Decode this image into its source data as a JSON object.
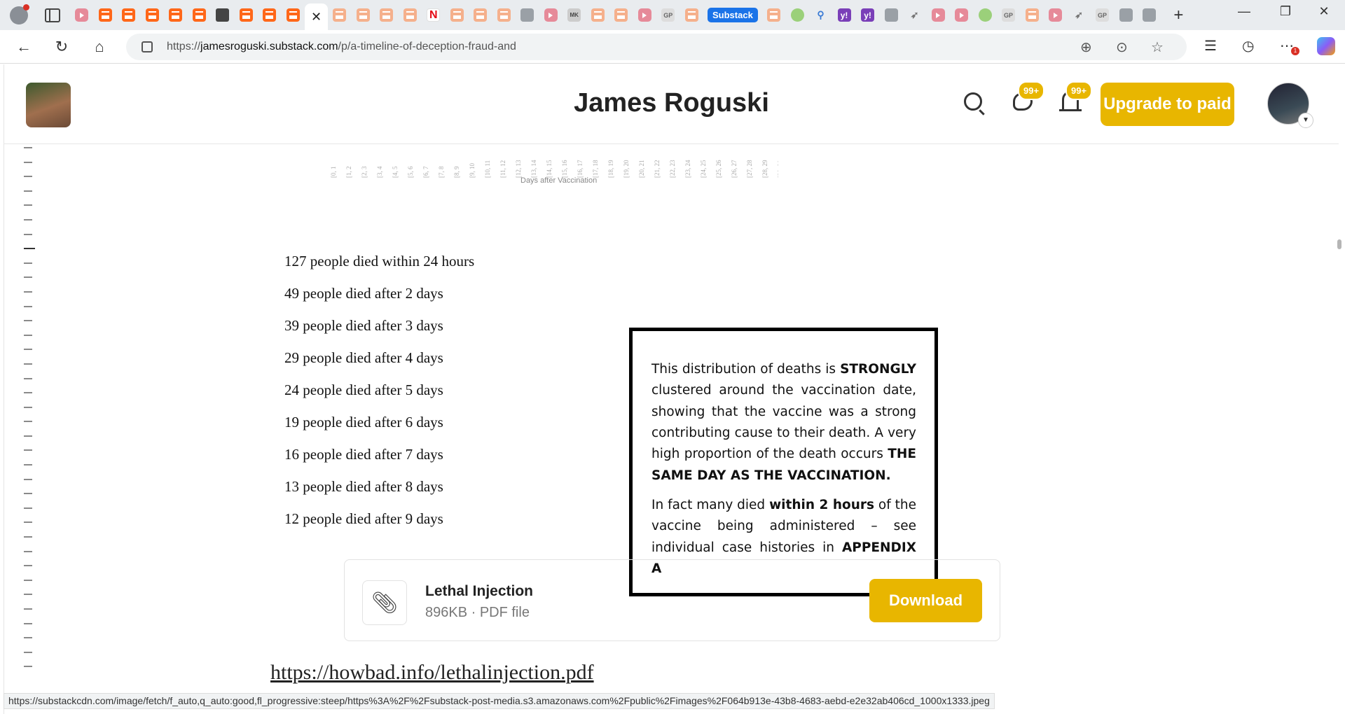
{
  "browser": {
    "substack_group_label": "Substack",
    "url_scheme": "https://",
    "url_domain": "jamesroguski.substack.com",
    "url_path": "/p/a-timeline-of-deception-fraud-and",
    "more_badge": "1",
    "status_url": "https://substackcdn.com/image/fetch/f_auto,q_auto:good,fl_progressive:steep/https%3A%2F%2Fsubstack-post-media.s3.amazonaws.com%2Fpublic%2Fimages%2F064b913e-43b8-4683-aebd-e2e32ab406cd_1000x1333.jpeg"
  },
  "header": {
    "site_title": "James Roguski",
    "chat_badge": "99+",
    "bell_badge": "99+",
    "upgrade_label": "Upgrade to paid",
    "accent_color": "#e8b600"
  },
  "document_image": {
    "axis_label": "Days after Vaccination",
    "axis_ticks": [
      "[0, 1",
      "[1, 2",
      "[2, 3",
      "[3, 4",
      "[4, 5",
      "[5, 6",
      "[6, 7",
      "[7, 8",
      "[8, 9",
      "[9, 10",
      "[10, 11",
      "[11, 12",
      "[12, 13",
      "[13, 14",
      "[14, 15",
      "[15, 16",
      "[16, 17",
      "[17, 18",
      "[18, 19",
      "[19, 20",
      "[20, 21",
      "[21, 22",
      "[22, 23",
      "[23, 24",
      "[24, 25",
      "[25, 26",
      "[26, 27",
      "[27, 28",
      "[28, 29",
      "[29, 30"
    ],
    "deaths": [
      "127 people died within 24 hours",
      "49 people died after 2 days",
      "39 people died after 3 days",
      "29 people died after 4 days",
      "24 people died after 5 days",
      "19 people died after 6 days",
      "16 people died after 7 days",
      "13 people died after 8 days",
      "12 people died after 9 days"
    ],
    "callout": {
      "p1_a": "This distribution of deaths is ",
      "p1_b": "STRONGLY",
      "p1_c": " clustered around the vaccination date, showing that the vaccine was a strong contributing cause to their death. A very high proportion of the death occurs ",
      "p1_d": "THE SAME DAY AS THE VACCINATION.",
      "p2_a": "In fact many died ",
      "p2_b": "within 2 hours",
      "p2_c": " of the vaccine being administered – see individual case histories in ",
      "p2_d": "APPENDIX A"
    }
  },
  "attachment": {
    "name": "Lethal Injection",
    "meta": "896KB · PDF file",
    "download_label": "Download"
  },
  "link": {
    "text": "https://howbad.info/lethalinjection.pdf"
  }
}
